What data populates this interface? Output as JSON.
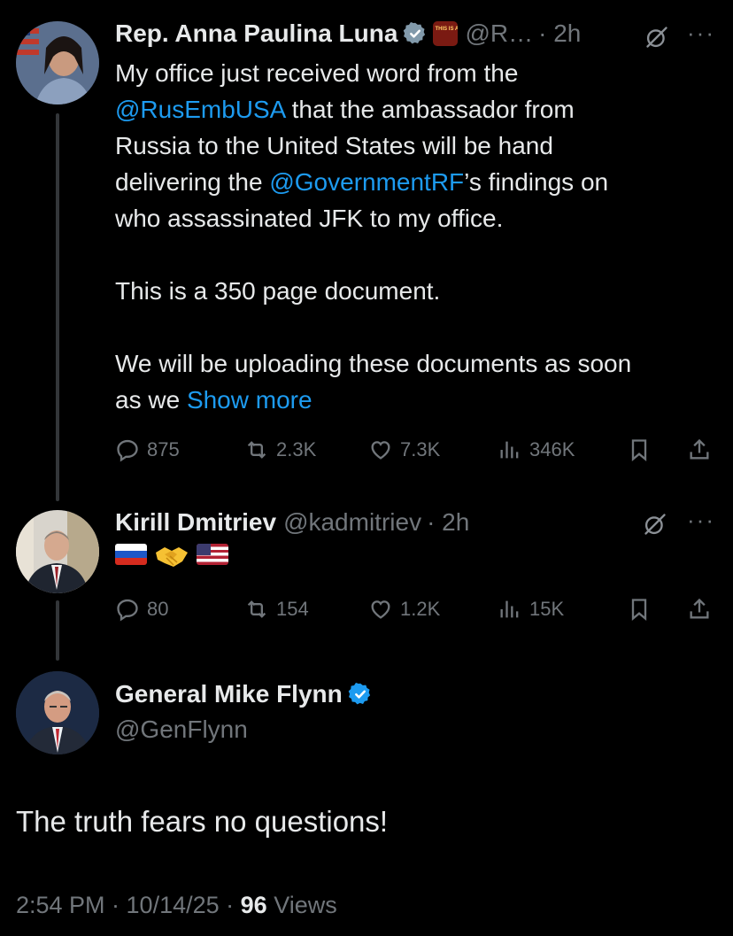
{
  "tweet1": {
    "name": "Rep. Anna Paulina Luna",
    "handle": "@R…",
    "time": "· 2h",
    "badge_text": "THIS IS A ...",
    "text_lines": {
      "l1": "My office just received word from the",
      "l2_mention": "@RusEmbUSA",
      "l2_rest": " that the ambassador from",
      "l3": "Russia to the United States will be hand",
      "l4_a": "delivering the ",
      "l4_mention": "@GovernmentRF",
      "l4_b": "’s findings on",
      "l5": "who assassinated JFK to my office.",
      "l6": "This is a 350 page document.",
      "l7": "We will be uploading these documents as soon",
      "l8_a": "as we ",
      "l8_more": "Show more"
    },
    "replies": "875",
    "reposts": "2.3K",
    "likes": "7.3K",
    "views": "346K"
  },
  "tweet2": {
    "name": "Kirill Dmitriev",
    "handle": "@kadmitriev",
    "time": "· 2h",
    "emojis": [
      "russia-flag",
      "handshake",
      "us-flag"
    ],
    "replies": "80",
    "reposts": "154",
    "likes": "1.2K",
    "views": "15K"
  },
  "tweet3": {
    "name": "General Mike Flynn",
    "handle": "@GenFlynn",
    "text": "The truth fears no questions!",
    "timestamp": "2:54 PM · 10/14/25 · ",
    "view_count": "96",
    "views_label": " Views"
  },
  "colors": {
    "background": "#000000",
    "text": "#e7e9ea",
    "secondary": "#71767b",
    "accent": "#1d9bf0"
  }
}
